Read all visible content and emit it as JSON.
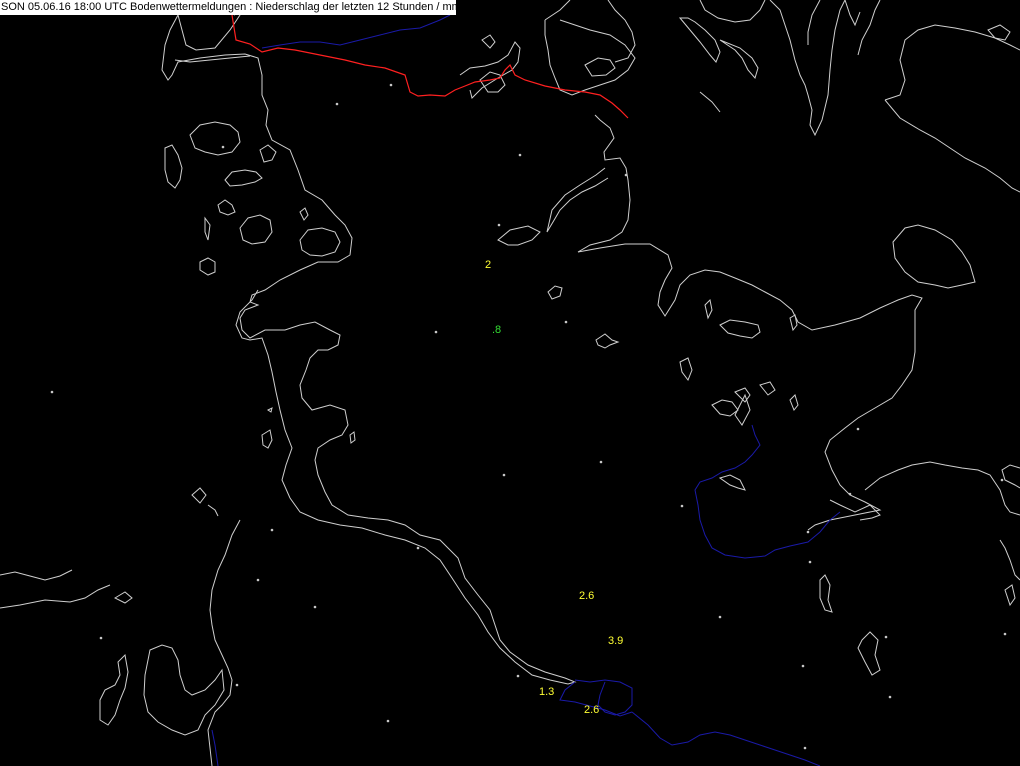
{
  "title": "SON 05.06.16 18:00 UTC  Bodenwettermeldungen :  Niederschlag der letzten 12 Stunden  / mm",
  "colors": {
    "background": "#000000",
    "coastline": "#cfcfcf",
    "border": "#ff2020",
    "river": "#1a1aa8",
    "station": "#c8c8c8",
    "value_default": "#ffff33",
    "value_low": "#33dd33"
  },
  "stations": [
    {
      "id": "s1",
      "precip": "2",
      "color": "#ffff33"
    },
    {
      "id": "s2",
      "precip": ".8",
      "color": "#33dd33"
    },
    {
      "id": "s3",
      "precip": "2.6",
      "color": "#ffff33"
    },
    {
      "id": "s4",
      "precip": "3.9",
      "color": "#ffff33"
    },
    {
      "id": "s5",
      "precip": "1.3",
      "color": "#ffff33"
    },
    {
      "id": "s6",
      "precip": "2.6",
      "color": "#ffff33"
    }
  ]
}
